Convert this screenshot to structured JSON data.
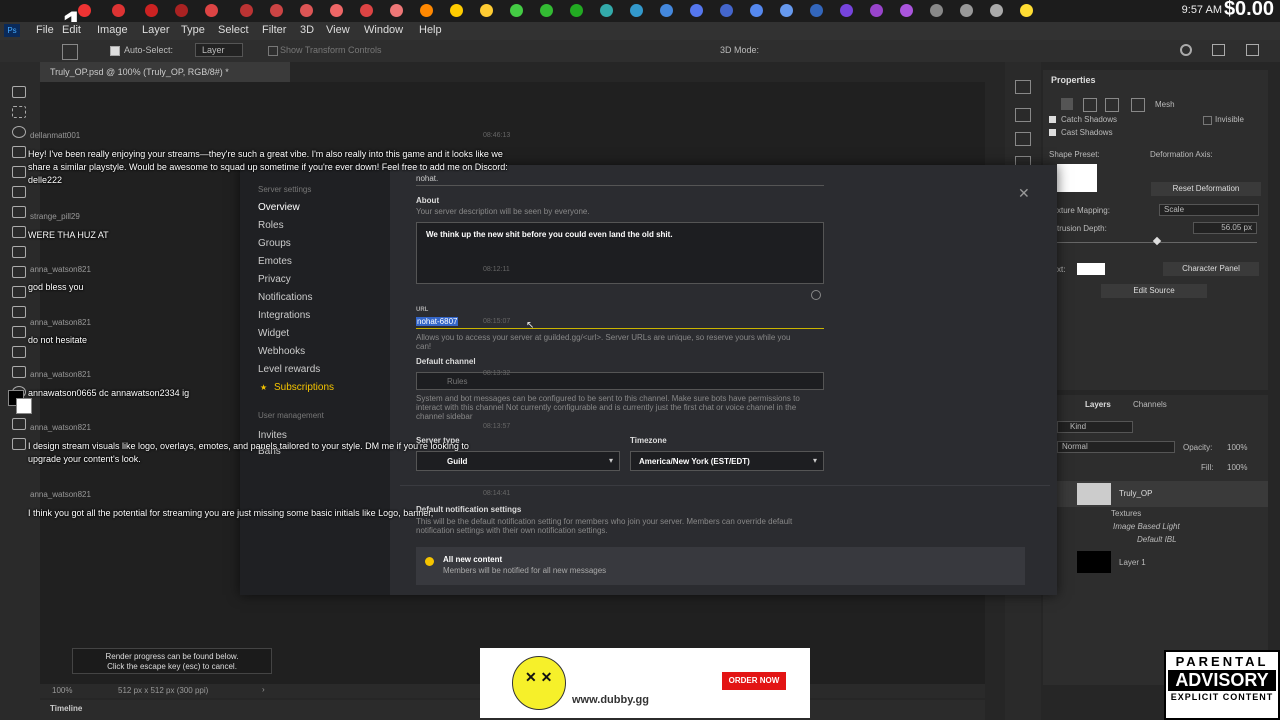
{
  "stream_overlay": {
    "counter": "1",
    "money": "$0.00"
  },
  "taskbar": {
    "time": "9:57 AM"
  },
  "menu": [
    "File",
    "Edit",
    "Image",
    "Layer",
    "Type",
    "Select",
    "Filter",
    "3D",
    "View",
    "Window",
    "Help"
  ],
  "options": {
    "auto_select": "Auto-Select:",
    "layer_dropdown": "Layer",
    "transform": "Show Transform Controls",
    "mode_3d": "3D Mode:"
  },
  "document": {
    "tab": "Truly_OP.psd @ 100% (Truly_OP, RGB/8#) *",
    "zoom": "100%",
    "dimensions": "512 px x 512 px (300 ppi)",
    "timeline": "Timeline"
  },
  "toast": {
    "line1": "Render progress can be found below.",
    "line2": "Click the escape key (esc) to cancel."
  },
  "properties": {
    "title": "Properties",
    "mesh": "Mesh",
    "catch_shadows": "Catch Shadows",
    "cast_shadows": "Cast Shadows",
    "invisible": "Invisible",
    "shape_preset": "Shape Preset:",
    "deformation_axis": "Deformation Axis:",
    "reset_deformation": "Reset Deformation",
    "texture_mapping": "xture Mapping:",
    "scale": "Scale",
    "extrusion_depth": "trusion Depth:",
    "depth_value": "56.05 px",
    "text_label": "xt:",
    "character_panel": "Character Panel",
    "edit_source": "Edit Source"
  },
  "layers": {
    "tabs": [
      "Layers",
      "Channels"
    ],
    "kind": "Kind",
    "blend": "Normal",
    "opacity_label": "Opacity:",
    "opacity": "100%",
    "fill_label": "Fill:",
    "fill": "100%",
    "items": [
      {
        "name": "Truly_OP"
      },
      {
        "name": "Textures"
      },
      {
        "name": "Image Based Light"
      },
      {
        "name": "Default IBL"
      },
      {
        "name": "Layer 1"
      }
    ]
  },
  "modal": {
    "sidebar_header": "Server settings",
    "sidebar_items": [
      "Overview",
      "Roles",
      "Groups",
      "Emotes",
      "Privacy",
      "Notifications",
      "Integrations",
      "Widget",
      "Webhooks",
      "Level rewards",
      "Subscriptions"
    ],
    "user_mgmt_header": "User management",
    "user_mgmt_items": [
      "Invites",
      "Bans"
    ],
    "server_name_value": "nohat.",
    "about_label": "About",
    "about_hint": "Your server description will be seen by everyone.",
    "about_value": "We think up the new shit before you could even land the old shit.",
    "url_label": "URL",
    "url_value": "nohat-6807",
    "url_hint": "Allows you to access your server at guilded.gg/<url>. Server URLs are unique, so reserve yours while you can!",
    "default_channel_label": "Default channel",
    "default_channel_value": "Rules",
    "default_channel_hint": "System and bot messages can be configured to be sent to this channel. Make sure bots have permissions to interact with this channel Not currently configurable and is currently just the first chat or voice channel in the channel sidebar",
    "server_type_label": "Server type",
    "server_type_value": "Guild",
    "timezone_label": "Timezone",
    "timezone_value": "America/New York (EST/EDT)",
    "notif_label": "Default notification settings",
    "notif_hint": "This will be the default notification setting for members who join your server. Members can override default notification settings with their own notification settings.",
    "notif_option_title": "All new content",
    "notif_option_desc": "Members will be notified for all new messages"
  },
  "chat": [
    {
      "name": "dellanmatt001",
      "time": "08:46:13",
      "msg": "Hey! I've been really enjoying your streams—they're such a great vibe. I'm also really into this game and it looks like we share a similar playstyle. Would be awesome to squad up sometime if you're ever down! Feel free to add me on Discord: delle222"
    },
    {
      "name": "strange_pill29",
      "time": "",
      "msg": "WERE THA HUZ AT"
    },
    {
      "name": "anna_watson821",
      "time": "08:12:11",
      "msg": "god bless you"
    },
    {
      "name": "anna_watson821",
      "time": "08:15:07",
      "msg": "do not hesitate"
    },
    {
      "name": "anna_watson821",
      "time": "08:13:32",
      "msg": "annawatson0665 dc annawatson2334 ig"
    },
    {
      "name": "anna_watson821",
      "time": "08:13:57",
      "msg": "I design stream visuals like logo, overlays, emotes, and panels tailored to your style. DM me if you're looking to upgrade your content's look."
    },
    {
      "name": "anna_watson821",
      "time": "08:14:41",
      "msg": "I think you got all the potential for streaming you are just missing some basic initials like Logo, banner,"
    }
  ],
  "ad": {
    "url": "www.dubby.gg",
    "cta": "ORDER NOW"
  },
  "advisory": {
    "line1": "PARENTAL",
    "line2": "ADVISORY",
    "line3": "EXPLICIT CONTENT"
  }
}
